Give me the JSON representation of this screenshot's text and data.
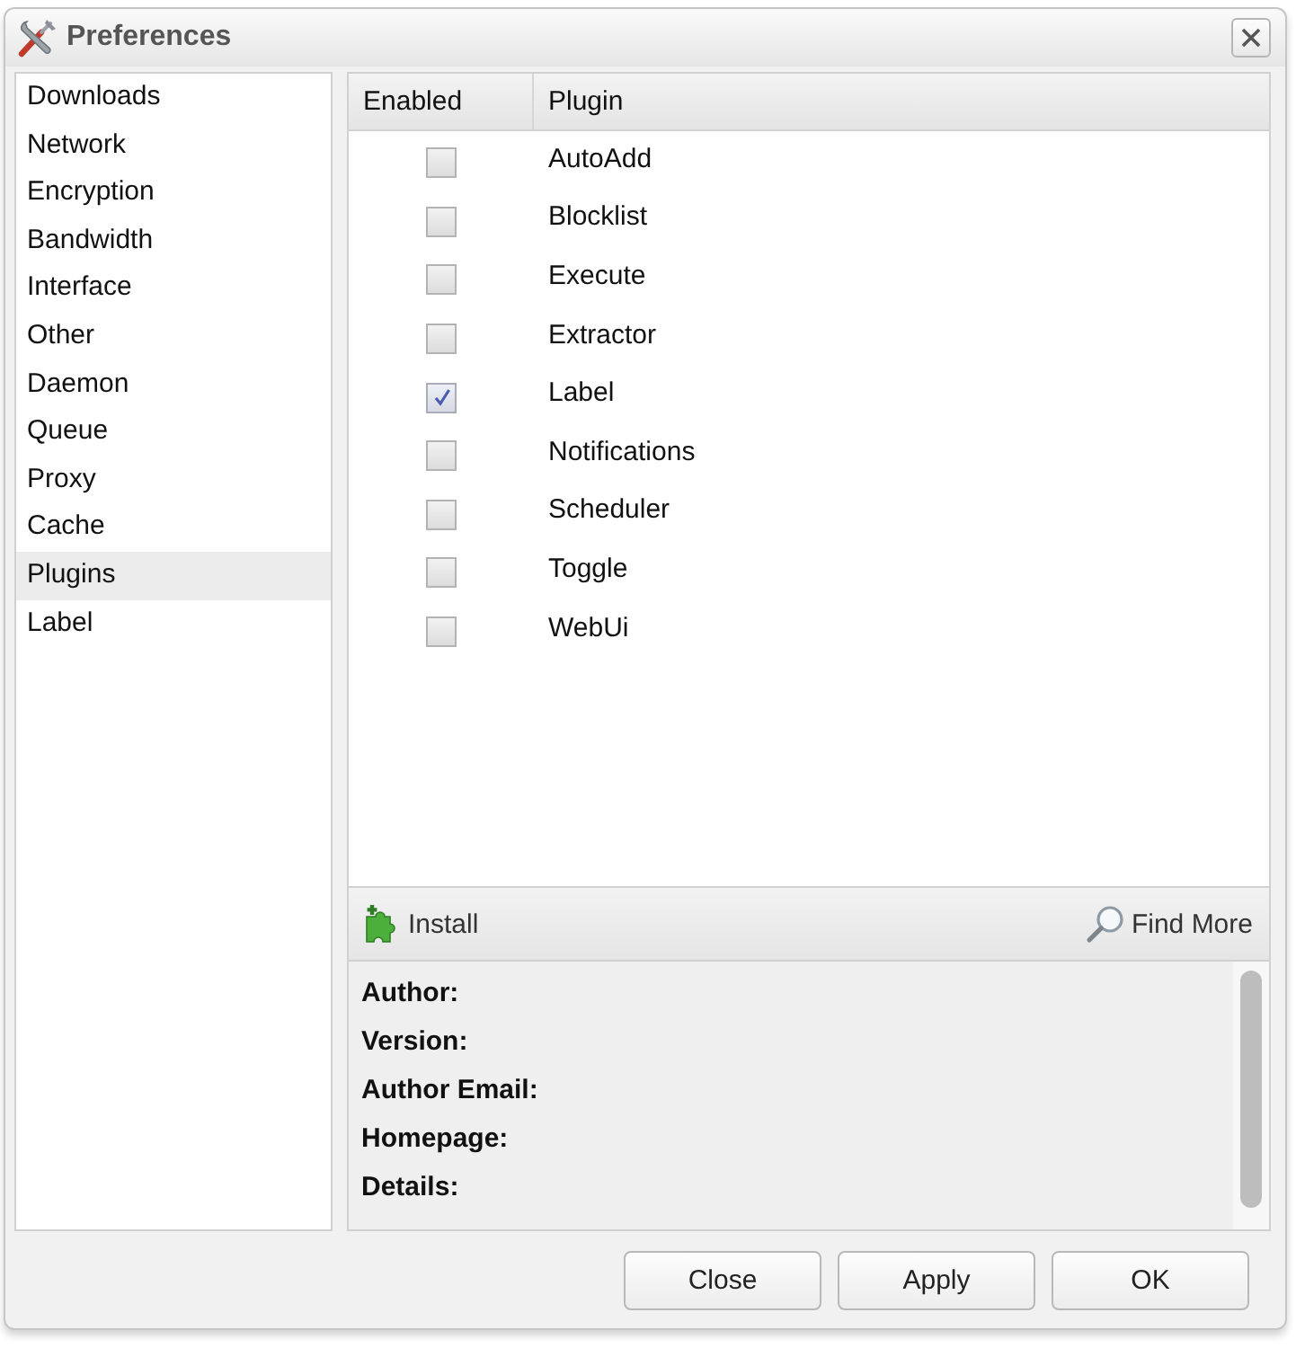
{
  "window": {
    "title": "Preferences"
  },
  "sidebar": {
    "items": [
      {
        "label": "Downloads",
        "selected": false
      },
      {
        "label": "Network",
        "selected": false
      },
      {
        "label": "Encryption",
        "selected": false
      },
      {
        "label": "Bandwidth",
        "selected": false
      },
      {
        "label": "Interface",
        "selected": false
      },
      {
        "label": "Other",
        "selected": false
      },
      {
        "label": "Daemon",
        "selected": false
      },
      {
        "label": "Queue",
        "selected": false
      },
      {
        "label": "Proxy",
        "selected": false
      },
      {
        "label": "Cache",
        "selected": false
      },
      {
        "label": "Plugins",
        "selected": true
      },
      {
        "label": "Label",
        "selected": false
      }
    ]
  },
  "plugins": {
    "columns": [
      "Enabled",
      "Plugin"
    ],
    "rows": [
      {
        "name": "AutoAdd",
        "enabled": false
      },
      {
        "name": "Blocklist",
        "enabled": false
      },
      {
        "name": "Execute",
        "enabled": false
      },
      {
        "name": "Extractor",
        "enabled": false
      },
      {
        "name": "Label",
        "enabled": true
      },
      {
        "name": "Notifications",
        "enabled": false
      },
      {
        "name": "Scheduler",
        "enabled": false
      },
      {
        "name": "Toggle",
        "enabled": false
      },
      {
        "name": "WebUi",
        "enabled": false
      }
    ]
  },
  "toolbar": {
    "install": "Install",
    "find_more": "Find More"
  },
  "details": {
    "fields": [
      "Author:",
      "Version:",
      "Author Email:",
      "Homepage:",
      "Details:"
    ]
  },
  "buttons": [
    "Close",
    "Apply",
    "OK"
  ]
}
